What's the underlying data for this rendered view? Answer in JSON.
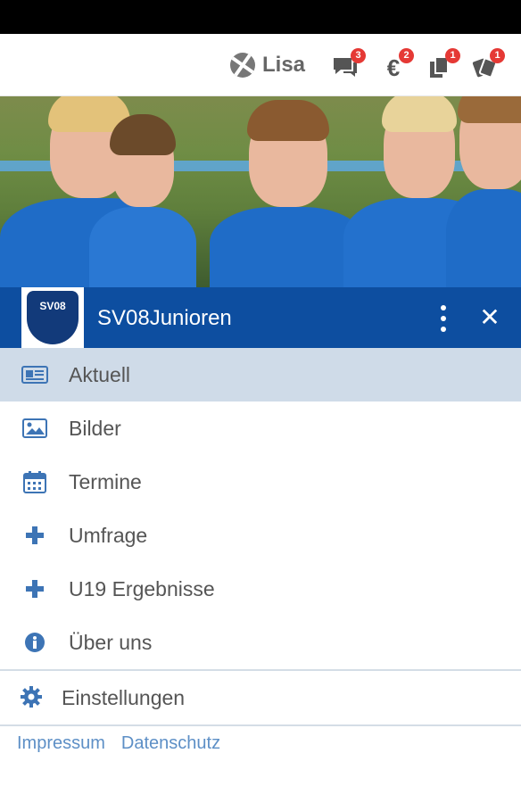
{
  "header": {
    "user_name": "Lisa",
    "icons": [
      {
        "name": "chat-icon",
        "badge": "3"
      },
      {
        "name": "euro-icon",
        "badge": "2"
      },
      {
        "name": "documents-icon",
        "badge": "1"
      },
      {
        "name": "tickets-icon",
        "badge": "1"
      }
    ]
  },
  "club": {
    "name": "SV08Junioren",
    "logo_text": "SV08"
  },
  "menu": {
    "items": [
      {
        "label": "Aktuell",
        "icon": "newspaper-icon",
        "active": true
      },
      {
        "label": "Bilder",
        "icon": "image-icon"
      },
      {
        "label": "Termine",
        "icon": "calendar-icon"
      },
      {
        "label": "Umfrage",
        "icon": "plus-icon"
      },
      {
        "label": "U19 Ergebnisse",
        "icon": "plus-icon"
      },
      {
        "label": "Über uns",
        "icon": "info-icon"
      }
    ],
    "settings_label": "Einstellungen"
  },
  "footer": {
    "impressum": "Impressum",
    "datenschutz": "Datenschutz"
  },
  "colors": {
    "primary": "#0d4ea0",
    "active_bg": "#cfdbe8",
    "icon": "#3d74b5",
    "badge": "#e53935",
    "link": "#5d8fc6"
  }
}
